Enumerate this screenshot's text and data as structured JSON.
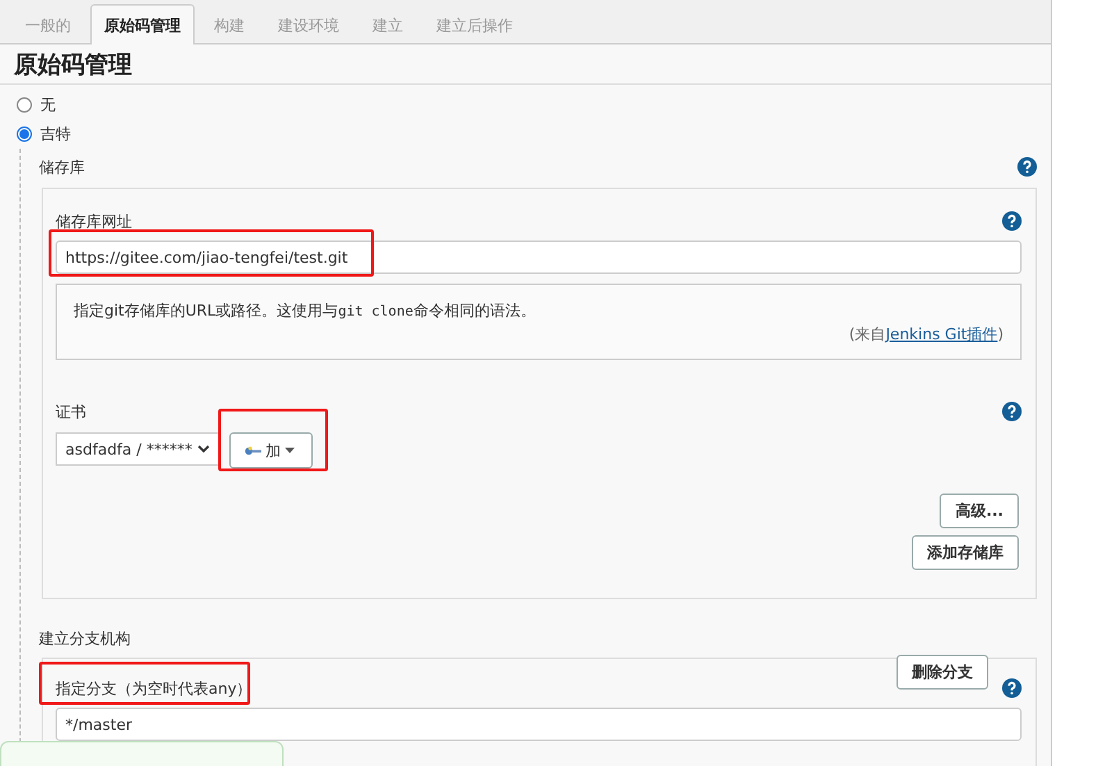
{
  "tabs": [
    {
      "label": "一般的",
      "selected": false
    },
    {
      "label": "原始码管理",
      "selected": true
    },
    {
      "label": "构建",
      "selected": false
    },
    {
      "label": "建设环境",
      "selected": false
    },
    {
      "label": "建立",
      "selected": false
    },
    {
      "label": "建立后操作",
      "selected": false
    }
  ],
  "heading": "原始码管理",
  "scm_options": [
    {
      "label": "无",
      "selected": false
    },
    {
      "label": "吉特",
      "selected": true
    }
  ],
  "repositories": {
    "title": "储存库",
    "url": {
      "label": "储存库网址",
      "value": "https://gitee.com/jiao-tengfei/test.git"
    },
    "help_text": {
      "before": "指定git存储库的URL或路径。这使用与",
      "code": "git clone",
      "after": "命令相同的语法。",
      "source_open": "(来自",
      "source_link": "Jenkins Git插件",
      "source_close": ")"
    },
    "credentials": {
      "label": "证书",
      "value": "asdfadfa / ******",
      "add_button": "加"
    },
    "advanced_button": "高级...",
    "add_repository_button": "添加存储库"
  },
  "branches": {
    "title": "建立分支机构",
    "delete_button": "删除分支",
    "label": "指定分支（为空时代表any）",
    "value": "*/master"
  }
}
